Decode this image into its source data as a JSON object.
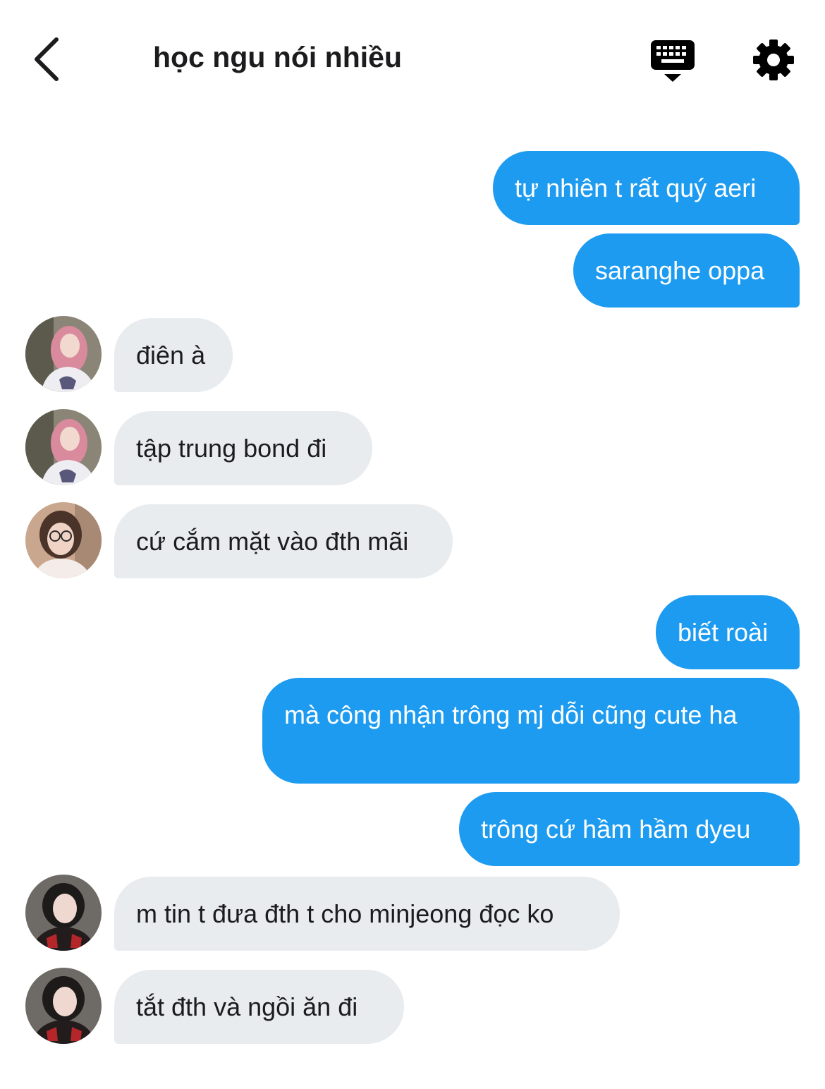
{
  "header": {
    "title": "học ngu nói nhiều",
    "back_icon": "chevron-left-icon",
    "keyboard_icon": "keyboard-icon",
    "settings_icon": "gear-icon"
  },
  "colors": {
    "outgoing_bubble": "#1d9bf0",
    "incoming_bubble": "#e8ecef",
    "text": "#1c1c1e"
  },
  "messages": [
    {
      "direction": "out",
      "text": "tự nhiên t rất quý aeri"
    },
    {
      "direction": "out",
      "text": "saranghe oppa"
    },
    {
      "direction": "in",
      "sender_avatar": "pink-hair-avatar",
      "text": "điên à"
    },
    {
      "direction": "in",
      "sender_avatar": "pink-hair-avatar",
      "text": "tập trung bond đi"
    },
    {
      "direction": "in",
      "sender_avatar": "glasses-avatar",
      "text": "cứ cắm mặt vào đth mãi"
    },
    {
      "direction": "out",
      "text": "biết roài"
    },
    {
      "direction": "out",
      "text": "mà công nhận trông mj dỗi cũng cute ha"
    },
    {
      "direction": "out",
      "text": "trông cứ hầm hầm dyeu"
    },
    {
      "direction": "in",
      "sender_avatar": "dark-hair-avatar",
      "text": "m tin t đưa đth t cho minjeong đọc ko"
    },
    {
      "direction": "in",
      "sender_avatar": "dark-hair-avatar",
      "text": "tắt đth và ngồi ăn đi"
    }
  ]
}
